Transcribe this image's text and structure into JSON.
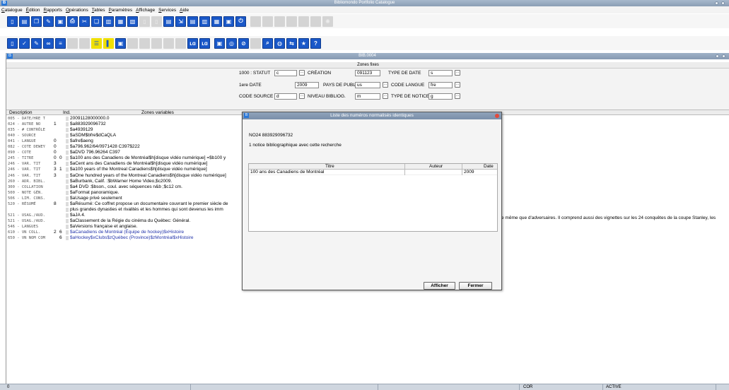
{
  "app": {
    "title": "Bibliomondo Portfolio Catalogue"
  },
  "menu": [
    "Catalogue",
    "Édition",
    "Rapports",
    "Opérations",
    "Tables",
    "Paramètres",
    "Affichage",
    "Services",
    "Aide"
  ],
  "record_window": {
    "title": "BIB.0004"
  },
  "fixed_fields": {
    "header": "Zones fixes",
    "rows": [
      [
        {
          "label": "1000 : STATUT",
          "value": "c"
        },
        {
          "label": "CRÉATION",
          "value": "091123"
        },
        {
          "label": "TYPE DE DATE",
          "value": "s"
        }
      ],
      [
        {
          "label": "1ere DATE",
          "value": "2009"
        },
        {
          "label": "PAYS DE PUBL.",
          "value": "us"
        },
        {
          "label": "CODE LANGUE",
          "value": "fre"
        }
      ],
      [
        {
          "label": "CODE SOURCE CAT.",
          "value": "d"
        },
        {
          "label": "NIVEAU BIBLIOG.",
          "value": "m"
        },
        {
          "label": "TYPE DE NOTICE",
          "value": "g"
        }
      ]
    ]
  },
  "grid": {
    "headers": {
      "description": "Description",
      "ind": "Ind.",
      "values": "Zones variables"
    },
    "rows": [
      {
        "desc": "005 - DATE/HRE T",
        "i1": "",
        "i2": "",
        "value": "20091128000000.0",
        "blue": false
      },
      {
        "desc": "024 - AUTRE NO",
        "i1": "1",
        "i2": "",
        "value": "$a883929096732",
        "blue": false
      },
      {
        "desc": "035 - # CONTRÔLE",
        "i1": "",
        "i2": "",
        "value": "$a4939129",
        "blue": false
      },
      {
        "desc": "040 - SOURCE",
        "i1": "",
        "i2": "",
        "value": "$aSDM$bfre$dCaQLA",
        "blue": false
      },
      {
        "desc": "041 - LANGUE",
        "i1": "0",
        "i2": "",
        "value": "$afre$aeng",
        "blue": false
      },
      {
        "desc": "082 - COTE DEWEY",
        "i1": "0",
        "i2": "",
        "value": "$a796.962/64/0971428 C397$222",
        "blue": false
      },
      {
        "desc": "090 - COTE",
        "i1": "0",
        "i2": "",
        "value": "$aDVD 796.96264 C397",
        "blue": false
      },
      {
        "desc": "245 - TITRE",
        "i1": "0",
        "i2": "0",
        "value": "$a100 ans des Canadiens de Montréal$h[disque vidéo numérique] =$b100 y",
        "blue": false
      },
      {
        "desc": "246 - VAR. TIT",
        "i1": "3",
        "i2": "",
        "value": "$aCent ans des Canadiens de Montréal$h[disque vidéo numérique]",
        "blue": false
      },
      {
        "desc": "246 - VAR. TIT",
        "i1": "3",
        "i2": "1",
        "value": "$a100 years of the Montreal Canadiens$h[disque vidéo numérique]",
        "blue": false
      },
      {
        "desc": "246 - VAR. TIT",
        "i1": "3",
        "i2": "",
        "value": "$aOne hundred years of the Montreal Canadiens$h[disque vidéo numérique]",
        "blue": false
      },
      {
        "desc": "260 - ADR. BIBL.",
        "i1": "",
        "i2": "",
        "value": "$aBurbank, Calif. :$bWarner Home Video,$c2009.",
        "blue": false
      },
      {
        "desc": "300 - COLLATION",
        "i1": "",
        "i2": "",
        "value": "$a4 DVD :$bson., coul. avec séquences n&b ;$c12 cm.",
        "blue": false
      },
      {
        "desc": "500 - NOTE GÉN.",
        "i1": "",
        "i2": "",
        "value": "$aFormat panoramique.",
        "blue": false
      },
      {
        "desc": "506 - LIM. CONS.",
        "i1": "",
        "i2": "",
        "value": "$aUsage privé seulement",
        "blue": false
      },
      {
        "desc": "520 - RÉSUMÉ",
        "i1": "8",
        "i2": "",
        "value": "$aRésumé: Ce coffret propose un documentaire couvrant le premier siècle de",
        "blue": false
      },
      {
        "desc": "",
        "i1": "",
        "i2": "",
        "value": "plus grandes dynasties et rivalités et les hommes qui sont devenus les imm",
        "blue": false
      },
      {
        "desc": "521 - USAG./AUD.",
        "i1": "",
        "i2": "",
        "value": "$aJA 4.",
        "blue": false
      },
      {
        "desc": "521 - USAG./AUD.",
        "i1": "",
        "i2": "",
        "value": "$aClassement de la Régie du cinéma du Québec: Général.",
        "blue": false
      },
      {
        "desc": "546 - LANGUES",
        "i1": "",
        "i2": "",
        "value": "$aVersions française et anglaise.",
        "blue": false
      },
      {
        "desc": "610 - VN COLL.",
        "i1": "2",
        "i2": "6",
        "value": "$aCanadiens de Montréal (Équipe de hockey)$xHistoire",
        "blue": true
      },
      {
        "desc": "650 - VN NOM COM",
        "i1": "",
        "i2": "6",
        "value": "$aHockey$xClubs$zQuébec (Province)$zMontréal$xHistoire",
        "blue": true
      }
    ],
    "overflow_text": "e même que d'adversaires. Il comprend aussi des vignettes sur les 24 conquêtes de la coupe Stanley, les"
  },
  "dialog": {
    "title": "Liste des numéros normalisés identiques",
    "number": "NO24 883929096732",
    "count_text": "1 notice bibliographique avec cette recherche",
    "columns": {
      "titre": "Titre",
      "auteur": "Auteur",
      "date": "Date"
    },
    "results": [
      {
        "titre": "100 ans des Canadiens de Montréal",
        "auteur": "",
        "date": "2009"
      }
    ],
    "buttons": {
      "show": "Afficher",
      "close": "Fermer"
    }
  },
  "status": {
    "left": "0",
    "mode": "COR",
    "state": "ACTIVE"
  },
  "colors": {
    "accent": "#1a58c8",
    "titlebar": "#8a9db4",
    "link": "#2233aa"
  }
}
